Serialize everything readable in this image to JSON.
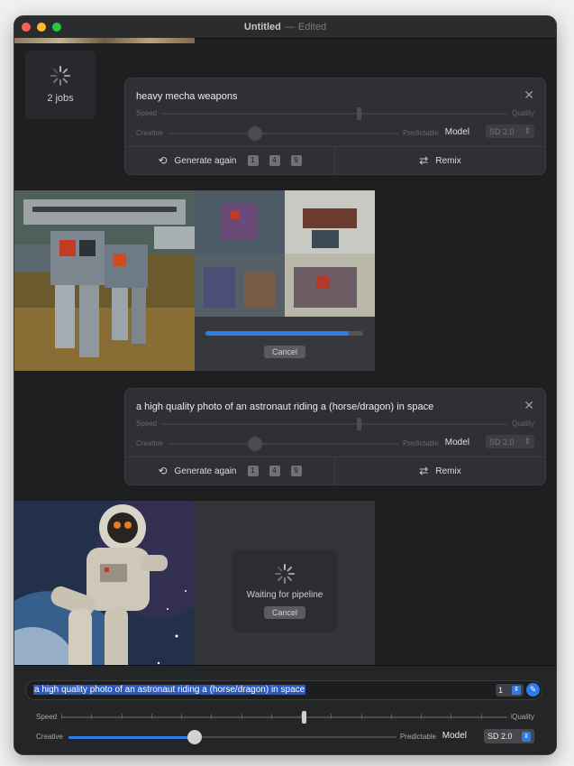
{
  "window": {
    "title": "Untitled",
    "separator": "—",
    "status": "Edited"
  },
  "jobs": {
    "label": "2 jobs"
  },
  "cards": [
    {
      "prompt": "heavy mecha weapons",
      "speed_label": "Speed",
      "quality_label": "Quality",
      "creative_label": "Creative",
      "predictable_label": "Predictable",
      "model_label": "Model",
      "model_value": "SD 2.0",
      "generate_label": "Generate again",
      "counts": [
        "1",
        "4",
        "9"
      ],
      "remix_label": "Remix"
    },
    {
      "prompt": "a high quality photo of an astronaut riding a (horse/dragon) in space",
      "speed_label": "Speed",
      "quality_label": "Quality",
      "creative_label": "Creative",
      "predictable_label": "Predictable",
      "model_label": "Model",
      "model_value": "SD 2.0",
      "generate_label": "Generate again",
      "counts": [
        "1",
        "4",
        "9"
      ],
      "remix_label": "Remix"
    }
  ],
  "generation1": {
    "progress": 0.91,
    "cancel_label": "Cancel"
  },
  "generation2": {
    "status": "Waiting for pipeline",
    "cancel_label": "Cancel"
  },
  "bottom": {
    "prompt": "a high quality photo of an astronaut riding a (horse/dragon) in space",
    "count_value": "1",
    "speed_label": "Speed",
    "quality_label": "Quality",
    "creative_label": "Creative",
    "predictable_label": "Predictable",
    "model_label": "Model",
    "model_value": "SD 2.0",
    "speed_level": 0.54,
    "creative_level": 0.38
  },
  "colors": {
    "accent": "#2f7bea",
    "window_bg": "#1e1f21",
    "card_bg": "#2f3033"
  },
  "icons": {
    "spinner": "spinner-icon",
    "close": "close-icon",
    "generate": "repeat-icon",
    "remix": "shuffle-icon",
    "chevrons": "chevron-updown-icon",
    "pencil": "pencil-icon"
  }
}
